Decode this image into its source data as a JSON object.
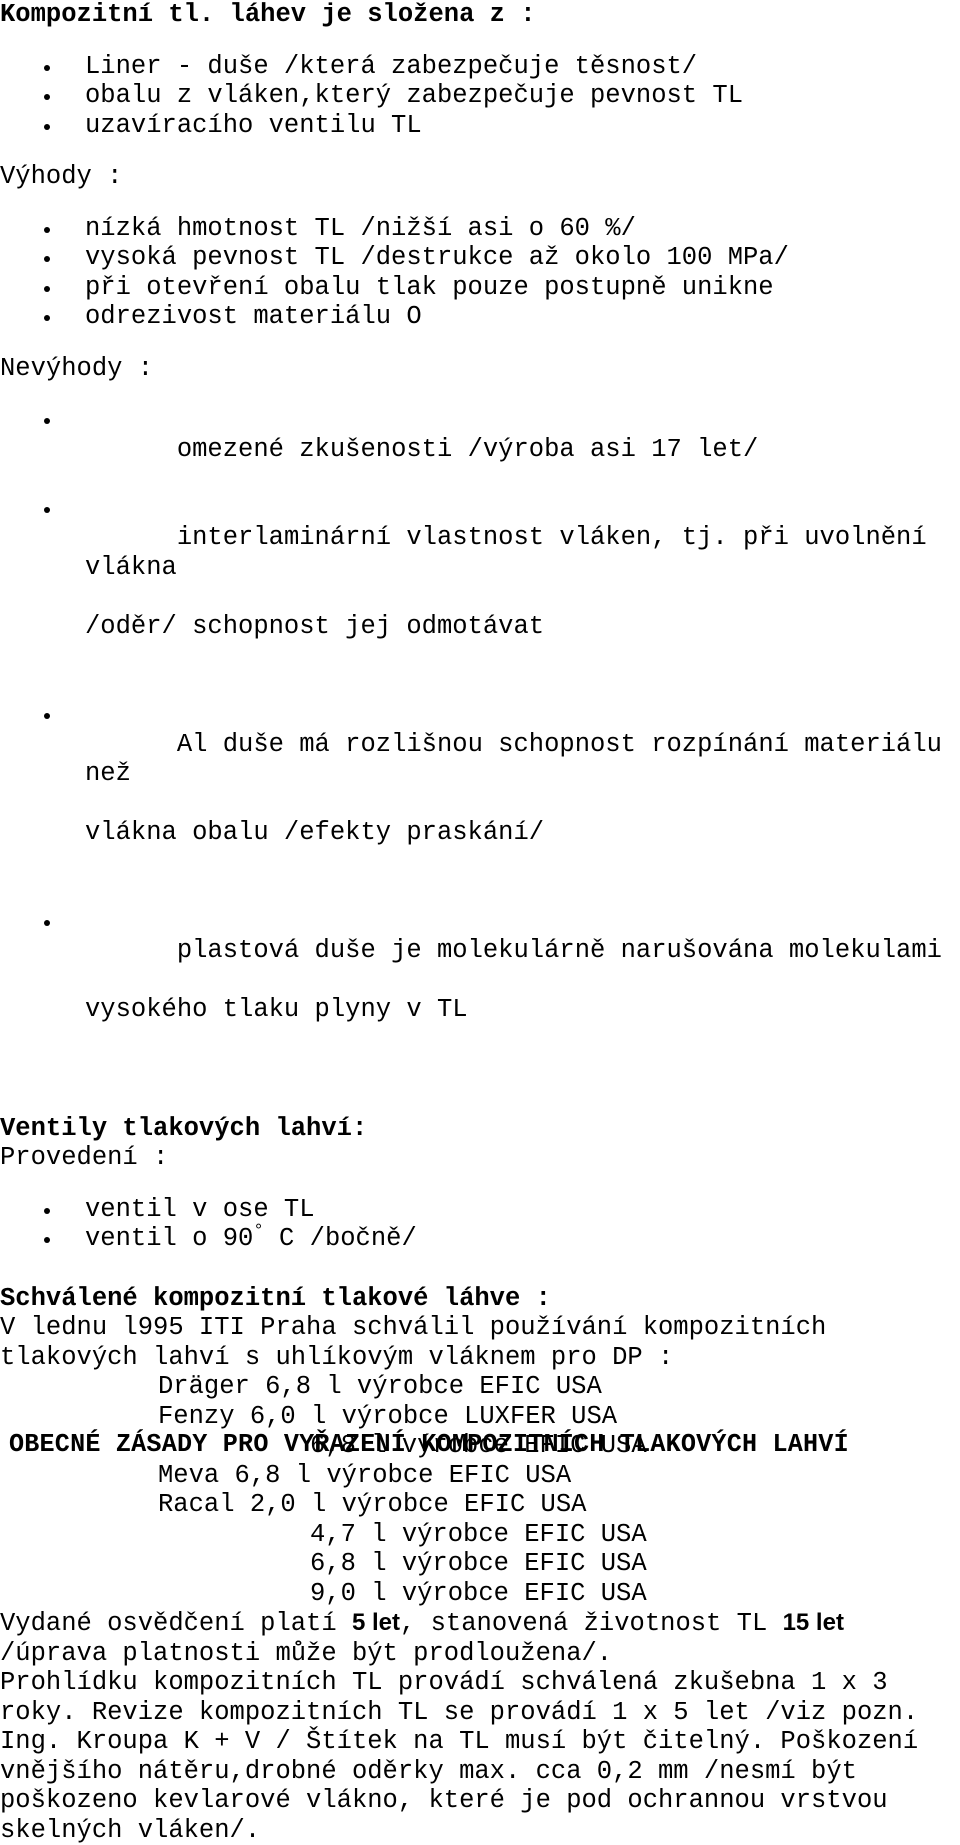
{
  "document": {
    "language": "cs",
    "background_color": "#ffffff",
    "text_color": "#000000"
  },
  "sections": {
    "composition": {
      "heading": "Kompozitní tl. láhev je složena z :",
      "items": [
        "Liner - duše /která zabezpečuje těsnost/",
        "obalu z vláken,který zabezpečuje pevnost TL",
        "uzavíracího ventilu TL"
      ]
    },
    "advantages": {
      "heading": "Výhody :",
      "items": [
        "nízká hmotnost TL /nižší asi o 60 %/",
        "vysoká pevnost TL /destrukce až okolo 100 MPa/",
        "při otevření obalu tlak pouze postupně unikne",
        "odrezivost materiálu O"
      ]
    },
    "disadvantages": {
      "heading": "Nevýhody :",
      "items": [
        {
          "line1": "omezené zkušenosti /výroba asi 17 let/",
          "line2": ""
        },
        {
          "line1": "interlaminární vlastnost vláken, tj. při uvolnění vlákna",
          "line2": "/oděr/ schopnost jej odmotávat"
        },
        {
          "line1": "Al duše má rozlišnou schopnost rozpínání materiálu než",
          "line2": "vlákna obalu /efekty praskání/"
        },
        {
          "line1": "plastová duše je molekulárně narušována molekulami",
          "line2": "vysokého tlaku plyny v TL"
        }
      ]
    },
    "valves": {
      "heading": "Ventily tlakových lahví:",
      "subheading": "Provedení :",
      "items_pre": [
        "ventil v ose TL"
      ],
      "item_degree_prefix": "ventil o 90",
      "item_degree_symbol": "°",
      "item_degree_suffix": " C /bočně/"
    },
    "approved": {
      "heading": "Schválené kompozitní tlakové láhve :",
      "intro_line1": "V ledny 1995 ITI Praha schválil používání kompozitních",
      "intro_line1_actual": "V lednu l995 ITI Praha schválil používání kompozitních",
      "intro_line2": "tlakových lahví s uhlíkovým vláknem pro DP :",
      "bottles": [
        {
          "indent": "brand",
          "text": "Dräger 6,8 l výrobce EFIC USA"
        },
        {
          "indent": "brand",
          "text": "Fenzy 6,0 l výrobce LUXFER USA"
        },
        {
          "indent": "size",
          "text": "6,8 l výrobce EFIC USA"
        },
        {
          "indent": "brand",
          "text": "Meva 6,8 l výrobce EFIC USA"
        },
        {
          "indent": "brand",
          "text": "Racal 2,0 l výrobce EFIC USA"
        },
        {
          "indent": "size",
          "text": "4,7 l výrobce EFIC USA"
        },
        {
          "indent": "size",
          "text": "6,8 l výrobce EFIC USA"
        },
        {
          "indent": "size",
          "text": "9,0 l výrobce EFIC USA"
        }
      ]
    },
    "validity": {
      "line1_a": "Vydané osvědčení platí ",
      "line1_bold1": "5 let",
      "line1_b": ", stanovená životnost TL ",
      "line1_bold2": "15 let",
      "line2": "/úprava platnosti může být prodloužena/.",
      "line3": "Prohlídku kompozitních TL provádí schválená zkušebna 1 x 3",
      "line4": "roky. Revize kompozitních TL se provádí 1 x 5 let /viz pozn.",
      "line5": "Ing. Kroupa K + V / Štítek na TL musí být čitelný. Poškození",
      "line6": "vnějšího nátěru,drobné oděrky max. cca 0,2 mm /nesmí být",
      "line7": "poškozeno kevlarové vlákno, které je pod ochrannou vrstvou",
      "line8": "skelných vláken/."
    },
    "final_heading": {
      "text": "OBECNÉ ZÁSADY PRO VYŘAZENÍ KOMPOZITNÍCH TLAKOVÝCH LAHVÍ"
    }
  }
}
